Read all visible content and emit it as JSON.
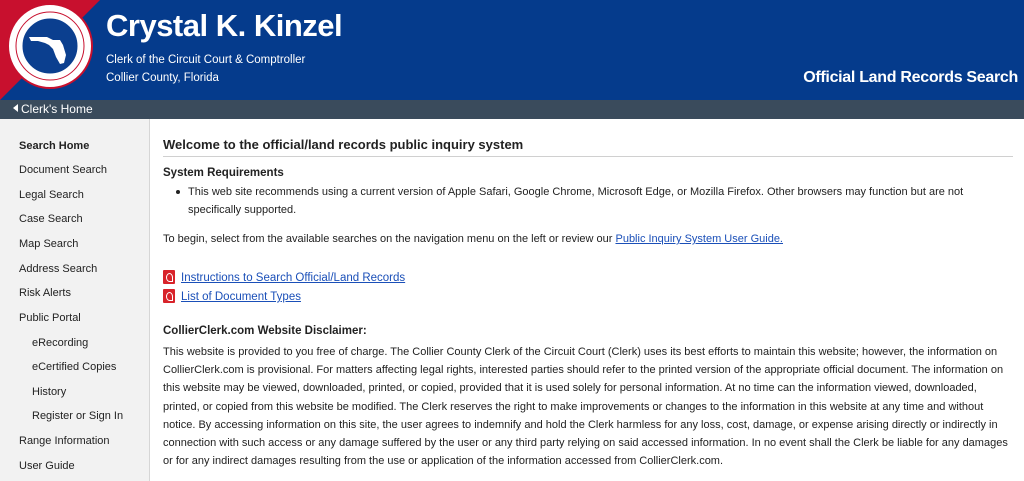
{
  "header": {
    "seal_text": "CLERK OF THE CIRCUIT COURT & COMPTROLLER · COLLIER COUNTY FLORIDA",
    "clerk_name": "Crystal K. Kinzel",
    "clerk_title": "Clerk of the Circuit Court & Comptroller",
    "county": "Collier County, Florida",
    "site_title": "Official Land Records Search",
    "colors": {
      "banner": "#053b8c",
      "accent": "#c8102e"
    }
  },
  "navbar": {
    "back_label": "Clerk's Home",
    "icon": "arrow-left-icon"
  },
  "sidebar": {
    "items": [
      {
        "label": "Search Home",
        "active": true
      },
      {
        "label": "Document Search"
      },
      {
        "label": "Legal Search"
      },
      {
        "label": "Case Search"
      },
      {
        "label": "Map Search"
      },
      {
        "label": "Address Search"
      },
      {
        "label": "Risk Alerts"
      },
      {
        "label": "Public Portal"
      },
      {
        "label": "eRecording",
        "sub": true
      },
      {
        "label": "eCertified Copies",
        "sub": true
      },
      {
        "label": "History",
        "sub": true
      },
      {
        "label": "Register or Sign In",
        "sub": true
      },
      {
        "label": "Range Information"
      },
      {
        "label": "User Guide"
      }
    ]
  },
  "main": {
    "welcome": "Welcome to the official/land records public inquiry system",
    "requirements_title": "System Requirements",
    "requirements_item": "This web site recommends using a current version of Apple Safari, Google Chrome, Microsoft Edge, or Mozilla Firefox. Other browsers may function but are not specifically supported.",
    "intro_text": "To begin, select from the available searches on the navigation menu on the left or review our ",
    "intro_link": "Public Inquiry System User Guide.",
    "doc_links": [
      {
        "label": "Instructions to Search Official/Land Records",
        "icon": "pdf-icon"
      },
      {
        "label": "List of Document Types",
        "icon": "pdf-icon"
      }
    ],
    "disclaimer_title": "CollierClerk.com Website Disclaimer:",
    "disclaimer_text": "This website is provided to you free of charge. The Collier County Clerk of the Circuit Court (Clerk) uses its best efforts to maintain this website; however, the information on CollierClerk.com is provisional. For matters affecting legal rights, interested parties should refer to the printed version of the appropriate official document. The information on this website may be viewed, downloaded, printed, or copied, provided that it is used solely for personal information. At no time can the information viewed, downloaded, printed, or copied from this website be modified. The Clerk reserves the right to make improvements or changes to the information in this website at any time and without notice. By accessing information on this site, the user agrees to indemnify and hold the Clerk harmless for any loss, cost, damage, or expense arising directly or indirectly in connection with such access or any damage suffered by the user or any third party relying on said accessed information. In no event shall the Clerk be liable for any damages or for any indirect damages resulting from the use or application of the information accessed from CollierClerk.com."
  }
}
